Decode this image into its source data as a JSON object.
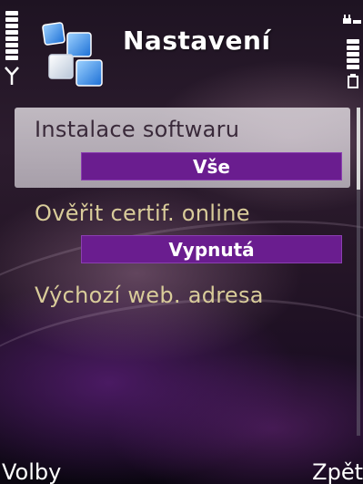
{
  "header": {
    "title": "Nastavení",
    "app_icon": "settings-blocks-icon"
  },
  "status": {
    "signal_icon": "antenna-icon",
    "battery_icon": "battery-icon",
    "charger_icon": "plug-icon"
  },
  "settings": [
    {
      "label": "Instalace softwaru",
      "value": "Vše",
      "selected": true
    },
    {
      "label": "Ověřit certif. online",
      "value": "Vypnutá",
      "selected": false
    },
    {
      "label": "Výchozí web. adresa",
      "value": "",
      "selected": false
    }
  ],
  "softkeys": {
    "left": "Volby",
    "right": "Zpět"
  },
  "colors": {
    "accent": "#6a1d8f",
    "label": "#d9cc9a",
    "highlight": "#e6e2e8"
  }
}
